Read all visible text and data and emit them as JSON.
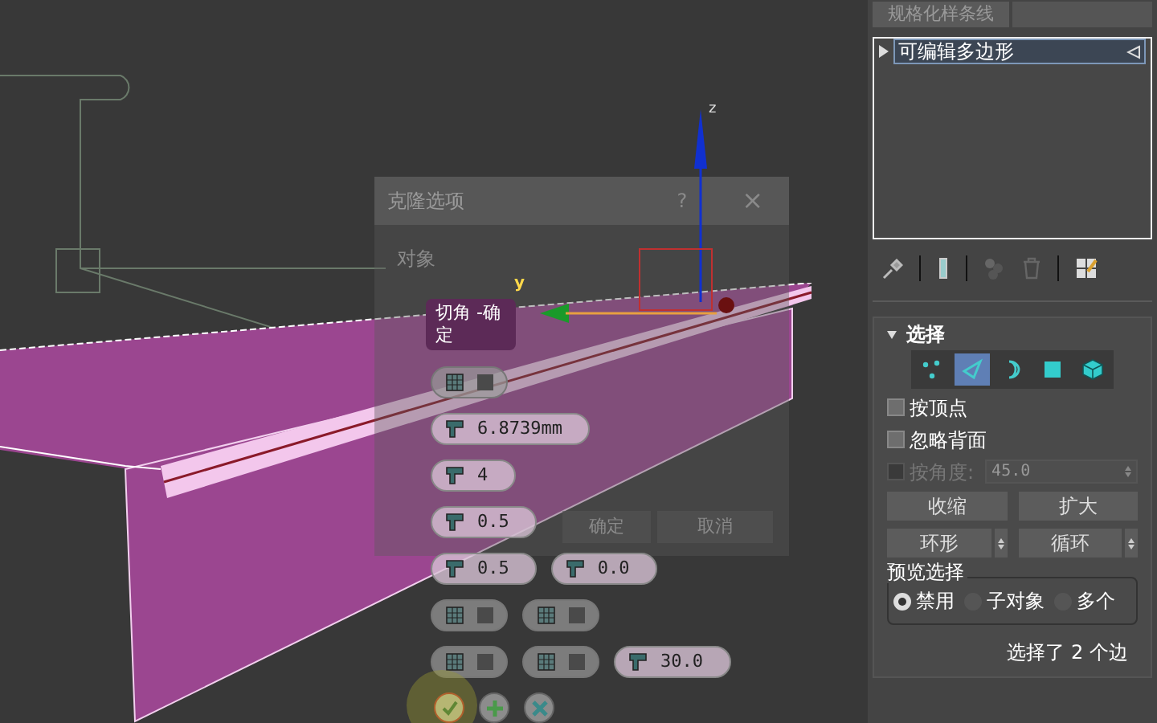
{
  "gizmo": {
    "z_label": "z",
    "y_label": "y"
  },
  "clone_dialog": {
    "title": "克隆选项",
    "help": "?",
    "close": "×",
    "section_label": "对象",
    "ok": "确定",
    "cancel": "取消"
  },
  "caddy": {
    "title": "切角 -确定",
    "rows": [
      [
        {
          "kind": "toggle"
        }
      ],
      [
        {
          "kind": "value",
          "value": "6.8739mm"
        }
      ],
      [
        {
          "kind": "value",
          "value": "4"
        }
      ],
      [
        {
          "kind": "value",
          "value": "0.5"
        }
      ],
      [
        {
          "kind": "value",
          "value": "0.5"
        },
        {
          "kind": "value",
          "value": "0.0"
        }
      ],
      [
        {
          "kind": "toggle"
        },
        {
          "kind": "toggle"
        }
      ],
      [
        {
          "kind": "toggle"
        },
        {
          "kind": "toggle"
        },
        {
          "kind": "value",
          "value": "30.0"
        }
      ]
    ],
    "actions": [
      {
        "kind": "ok"
      },
      {
        "kind": "apply"
      },
      {
        "kind": "cancel"
      }
    ]
  },
  "modifier_panel": {
    "top_button": "规格化样条线",
    "stack": [
      {
        "label": "可编辑多边形",
        "selected": true
      }
    ]
  },
  "selection": {
    "title": "选择",
    "expanded": true,
    "levels": [
      {
        "kind": "vertex",
        "selected": false
      },
      {
        "kind": "edge",
        "selected": true
      },
      {
        "kind": "border",
        "selected": false
      },
      {
        "kind": "polygon",
        "selected": false
      },
      {
        "kind": "element",
        "selected": false
      }
    ],
    "checkboxes": [
      {
        "kind": "plain",
        "label": "按顶点",
        "checked": false,
        "disabled": false
      },
      {
        "kind": "plain",
        "label": "忽略背面",
        "checked": false,
        "disabled": false
      },
      {
        "kind": "angle",
        "label": "按角度:",
        "checked": false,
        "disabled": true,
        "value": "45.0"
      }
    ],
    "buttons": [
      {
        "kind": "plain",
        "label": "收缩"
      },
      {
        "kind": "plain",
        "label": "扩大"
      },
      {
        "kind": "spinner",
        "label": "环形"
      },
      {
        "kind": "spinner",
        "label": "循环"
      }
    ],
    "preview": {
      "title": "预览选择",
      "options": [
        {
          "label": "禁用",
          "selected": true
        },
        {
          "label": "子对象",
          "selected": false
        },
        {
          "label": "多个",
          "selected": false
        }
      ]
    },
    "status": "选择了 2 个边"
  }
}
